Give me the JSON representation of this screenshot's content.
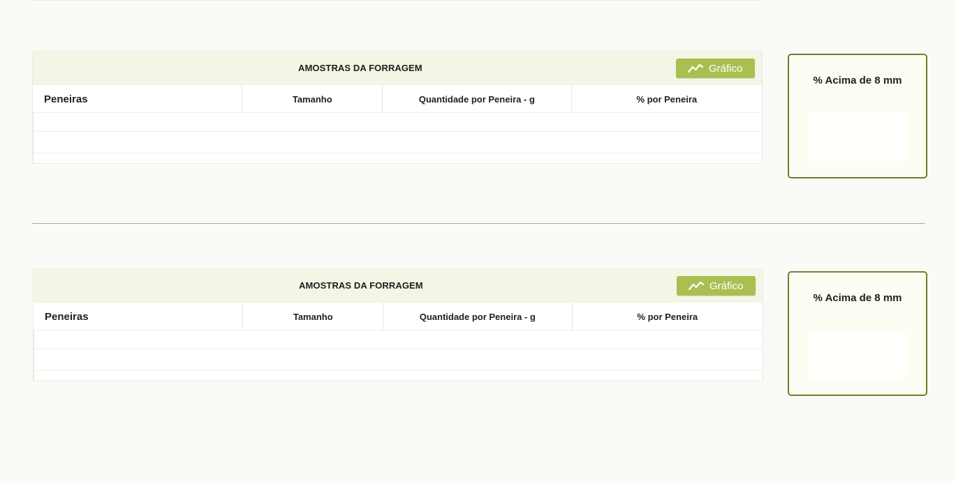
{
  "page": {
    "sections": [
      {
        "table": {
          "title": "AMOSTRAS DA FORRAGEM",
          "chart_button_label": "Gráfico",
          "columns": [
            "Peneiras",
            "Tamanho",
            "Quantidade por Peneira - g",
            "% por  Peneira"
          ]
        },
        "metric_card": {
          "title": "% Acima de 8 mm"
        }
      },
      {
        "table": {
          "title": "AMOSTRAS DA FORRAGEM",
          "chart_button_label": "Gráfico",
          "columns": [
            "Peneiras",
            "Tamanho",
            "Quantidade por Peneira - g",
            "% por  Peneira"
          ]
        },
        "metric_card": {
          "title": "% Acima de 8 mm"
        }
      }
    ]
  },
  "colors": {
    "accent_green": "#a9bf50",
    "card_border_green": "#6f7f2d",
    "header_bg": "#f3f6e6",
    "page_bg": "#fbfaf6"
  },
  "icons": {
    "chart_button_icon": "line-chart-icon"
  }
}
